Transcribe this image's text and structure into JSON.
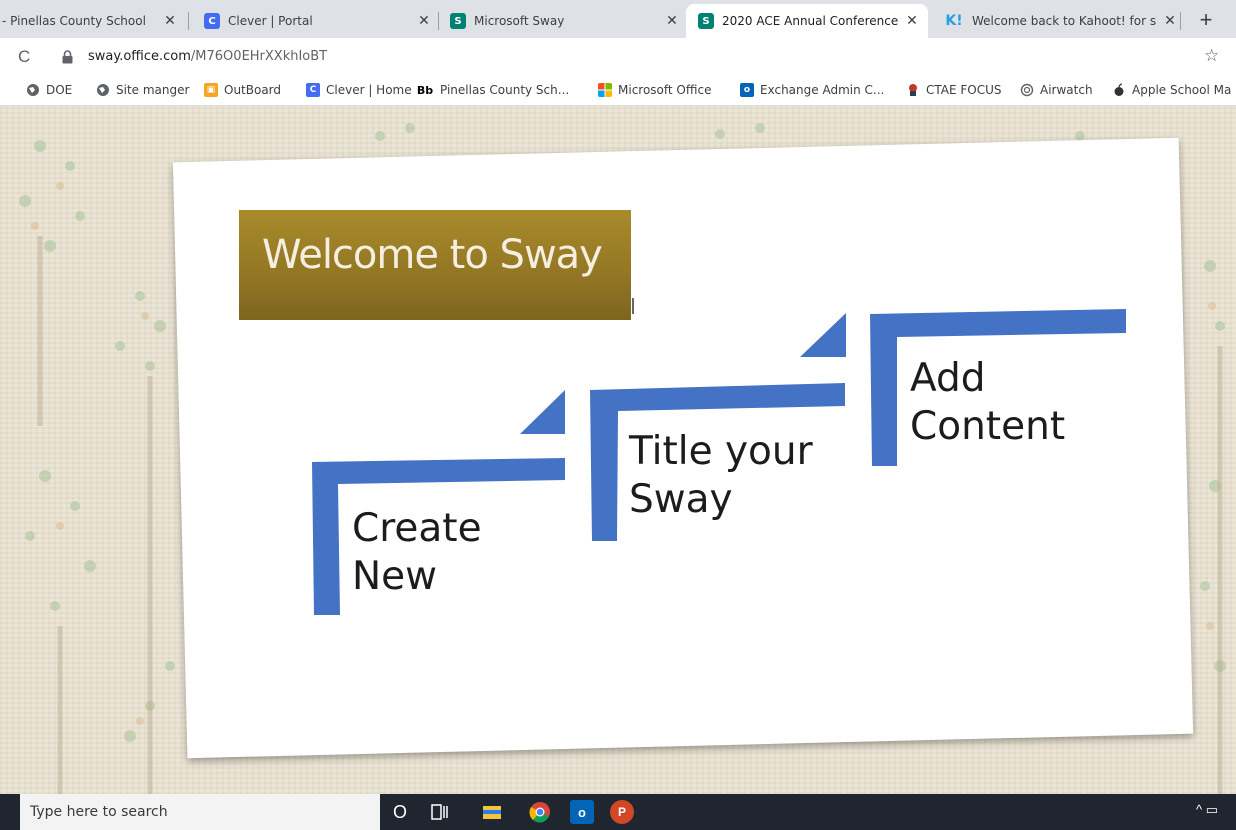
{
  "browser": {
    "tabs": [
      {
        "title": "- Pinellas County School",
        "icon": "pinellas-icon",
        "active": false
      },
      {
        "title": "Clever | Portal",
        "icon": "clever-icon",
        "active": false
      },
      {
        "title": "Microsoft Sway",
        "icon": "sway-icon",
        "active": false
      },
      {
        "title": "2020 ACE Annual Conference",
        "icon": "sway-icon",
        "active": true
      },
      {
        "title": "Welcome back to Kahoot! for s",
        "icon": "kahoot-icon",
        "active": false
      }
    ],
    "url_host": "sway.office.com",
    "url_path": "/M76O0EHrXXkhIoBT",
    "bookmarks": [
      {
        "label": "DOE",
        "icon": "globe-icon"
      },
      {
        "label": "Site manger",
        "icon": "globe-icon"
      },
      {
        "label": "OutBoard",
        "icon": "outboard-icon"
      },
      {
        "label": "Clever | Home",
        "icon": "clever-icon"
      },
      {
        "label": "Pinellas County Sch...",
        "icon": "blackboard-icon",
        "prefix": "Bb"
      },
      {
        "label": "Microsoft Office",
        "icon": "microsoft-icon"
      },
      {
        "label": "Exchange Admin C...",
        "icon": "outlook-icon"
      },
      {
        "label": "CTAE FOCUS",
        "icon": "focus-icon"
      },
      {
        "label": "Airwatch",
        "icon": "airwatch-icon"
      },
      {
        "label": "Apple School Ma",
        "icon": "apple-icon"
      }
    ],
    "clever_glyph": "C",
    "sway_glyph": "S",
    "kahoot_glyph": "K!",
    "outlook_glyph": "o"
  },
  "slide": {
    "title": "Welcome to Sway",
    "steps": [
      {
        "line1": "Create",
        "line2": "New"
      },
      {
        "line1": "Title your",
        "line2": "Sway"
      },
      {
        "line1": "Add",
        "line2": "Content"
      }
    ],
    "accent_color": "#4472c4",
    "title_box_color": "#927624"
  },
  "taskbar": {
    "search_placeholder": "Type here to search",
    "cortana_glyph": "O",
    "outlook_glyph": "o",
    "powerpoint_glyph": "P",
    "tray_chevron": "^"
  }
}
